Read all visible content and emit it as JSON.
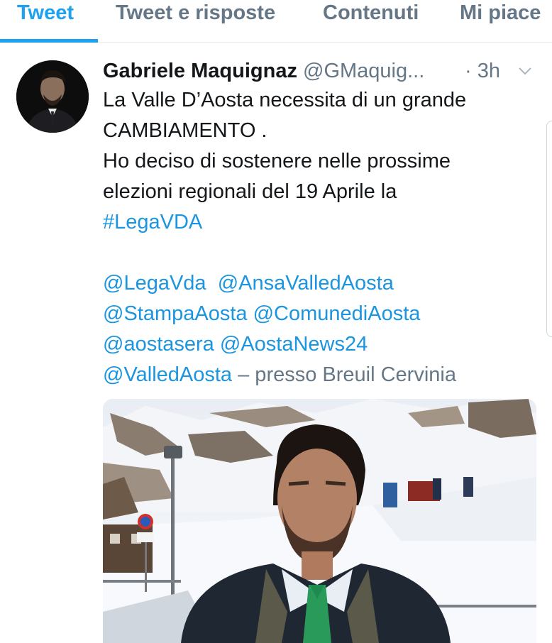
{
  "tabs": [
    {
      "label": "Tweet",
      "active": true
    },
    {
      "label": "Tweet e risposte",
      "active": false
    },
    {
      "label": "Contenuti",
      "active": false
    },
    {
      "label": "Mi piace",
      "active": false
    }
  ],
  "tweet": {
    "author_name": "Gabriele Maquignaz",
    "author_handle": "@GMaquig...",
    "time": "· 3h",
    "lines": {
      "l1": "La Valle D’Aosta necessita di un grande",
      "l2": "CAMBIAMENTO .",
      "l3": "Ho deciso di sostenere nelle prossime",
      "l4": "elezioni regionali del 19 Aprile la",
      "hashtag": "#LegaVDA",
      "mention_1": "@LegaVda",
      "mention_2": "@AnsaValledAosta",
      "mention_3": "@StampaAosta",
      "mention_4": "@ComunediAosta",
      "mention_5": "@aostasera",
      "mention_6": "@AostaNews24",
      "mention_7": "@ValledAosta",
      "location": "– presso Breuil Cervinia"
    }
  },
  "colors": {
    "accent": "#1da1f2",
    "link": "#1b95e0",
    "secondary_text": "#657786",
    "primary_text": "#14171a"
  },
  "icons": {
    "caret": "chevron-down-icon"
  }
}
